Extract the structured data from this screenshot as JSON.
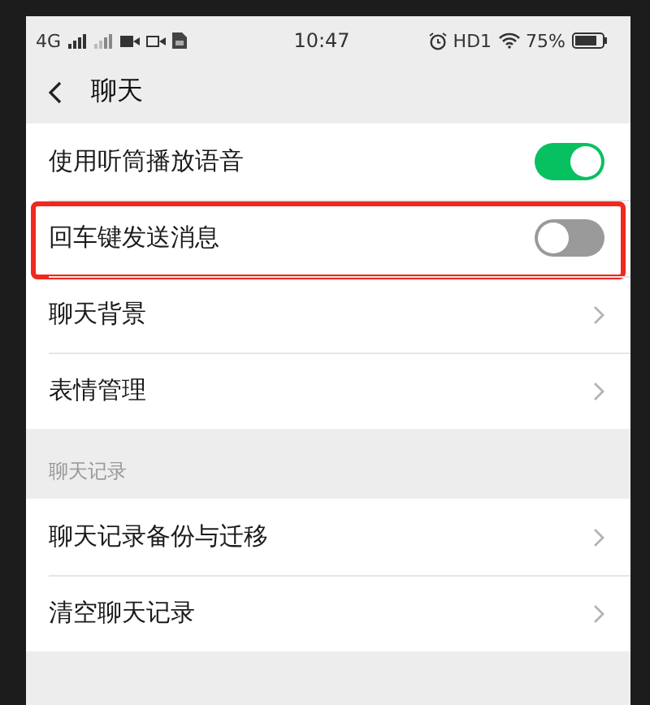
{
  "status_bar": {
    "network": "4G",
    "time": "10:47",
    "hd": "HD1",
    "battery": "75%"
  },
  "nav": {
    "title": "聊天"
  },
  "groups": [
    {
      "rows": [
        {
          "label": "使用听筒播放语音",
          "kind": "switch",
          "on": true,
          "highlighted": false
        },
        {
          "label": "回车键发送消息",
          "kind": "switch",
          "on": false,
          "highlighted": true
        },
        {
          "label": "聊天背景",
          "kind": "link",
          "highlighted": false
        },
        {
          "label": "表情管理",
          "kind": "link",
          "highlighted": false
        }
      ]
    },
    {
      "header": "聊天记录",
      "rows": [
        {
          "label": "聊天记录备份与迁移",
          "kind": "link",
          "highlighted": false
        },
        {
          "label": "清空聊天记录",
          "kind": "link",
          "highlighted": false
        }
      ]
    }
  ]
}
